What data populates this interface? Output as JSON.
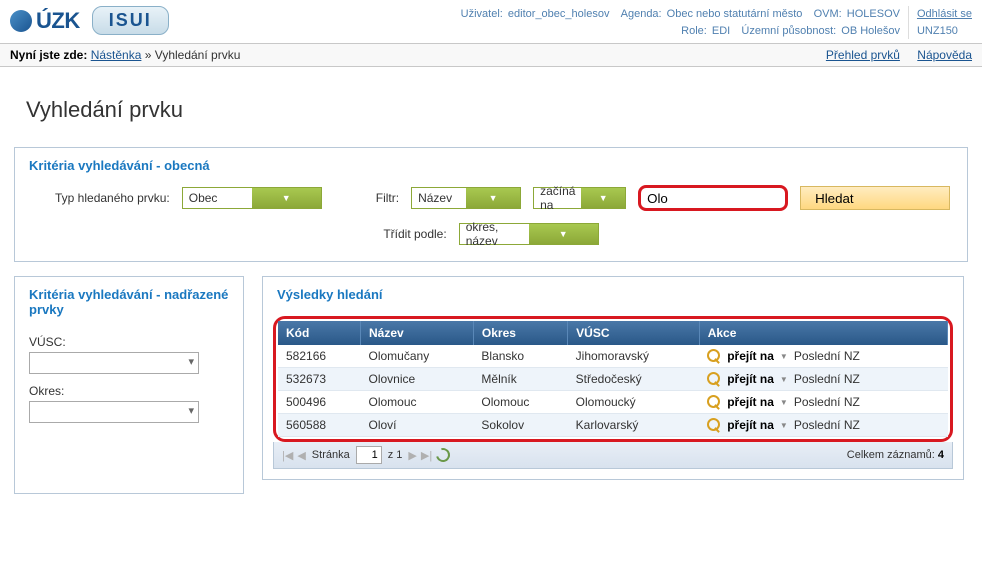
{
  "header": {
    "logo_text": "ÚZK",
    "isui_text": "ISUI",
    "user_label": "Uživatel:",
    "user": "editor_obec_holesov",
    "agenda_label": "Agenda:",
    "agenda": "Obec nebo statutární město",
    "ovm_label": "OVM:",
    "ovm": "HOLESOV",
    "role_label": "Role:",
    "role": "EDI",
    "scope_label": "Územní působnost:",
    "scope": "OB Holešov",
    "logout": "Odhlásit se",
    "code": "UNZ150"
  },
  "breadcrumb": {
    "prefix": "Nyní jste zde:",
    "item1": "Nástěnka",
    "sep": " » ",
    "item2": "Vyhledání prvku",
    "link_overview": "Přehled prvků",
    "link_help": "Nápověda"
  },
  "page_title": "Vyhledání prvku",
  "criteria": {
    "panel_title": "Kritéria vyhledávání - obecná",
    "type_label": "Typ hledaného prvku:",
    "type_value": "Obec",
    "filter_label": "Filtr:",
    "filter_field": "Název",
    "filter_op": "začíná na",
    "filter_value": "Olo",
    "search_btn": "Hledat",
    "sort_label": "Třídit podle:",
    "sort_value": "okres, název"
  },
  "side": {
    "panel_title": "Kritéria vyhledávání - nadřazené prvky",
    "vusc_label": "VÚSC:",
    "okres_label": "Okres:"
  },
  "results": {
    "panel_title": "Výsledky hledání",
    "columns": {
      "kod": "Kód",
      "nazev": "Název",
      "okres": "Okres",
      "vusc": "VÚSC",
      "akce": "Akce"
    },
    "action_goto": "přejít na",
    "action_last": "Poslední NZ",
    "rows": [
      {
        "kod": "582166",
        "nazev": "Olomučany",
        "okres": "Blansko",
        "vusc": "Jihomoravský"
      },
      {
        "kod": "532673",
        "nazev": "Olovnice",
        "okres": "Mělník",
        "vusc": "Středočeský"
      },
      {
        "kod": "500496",
        "nazev": "Olomouc",
        "okres": "Olomouc",
        "vusc": "Olomoucký"
      },
      {
        "kod": "560588",
        "nazev": "Oloví",
        "okres": "Sokolov",
        "vusc": "Karlovarský"
      }
    ]
  },
  "pager": {
    "page_label": "Stránka",
    "page_value": "1",
    "of_label": "z 1",
    "total_label": "Celkem záznamů:",
    "total": "4"
  }
}
